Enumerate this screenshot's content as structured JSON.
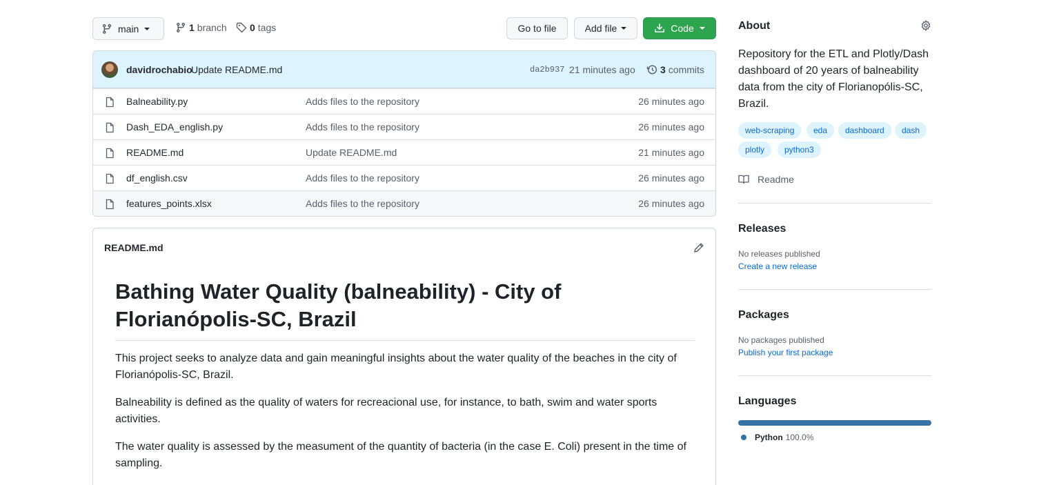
{
  "branch_select": {
    "label": "main"
  },
  "branches": {
    "count": "1",
    "label": "branch"
  },
  "tags": {
    "count": "0",
    "label": "tags"
  },
  "buttons": {
    "go_to_file": "Go to file",
    "add_file": "Add file",
    "code": "Code"
  },
  "commit": {
    "author": "davidrochabio",
    "message": "Update README.md",
    "sha": "da2b937",
    "age": "21 minutes ago",
    "commits_count": "3",
    "commits_label": "commits"
  },
  "files": [
    {
      "name": "Balneability.py",
      "message": "Adds files to the repository",
      "age": "26 minutes ago"
    },
    {
      "name": "Dash_EDA_english.py",
      "message": "Adds files to the repository",
      "age": "26 minutes ago"
    },
    {
      "name": "README.md",
      "message": "Update README.md",
      "age": "21 minutes ago"
    },
    {
      "name": "df_english.csv",
      "message": "Adds files to the repository",
      "age": "26 minutes ago"
    },
    {
      "name": "features_points.xlsx",
      "message": "Adds files to the repository",
      "age": "26 minutes ago"
    }
  ],
  "readme": {
    "filename": "README.md",
    "title": "Bathing Water Quality (balneability) - City of Florianópolis-SC, Brazil",
    "paragraphs": [
      "This project seeks to analyze data and gain meaningful insights about the water quality of the beaches in the city of Florianópolis-SC, Brazil.",
      "Balneability is defined as the quality of waters for recreacional use, for instance, to bath, swim and water sports activities.",
      "The water quality is assessed by the measument of the quantity of bacteria (in the case E. Coli) present in the time of sampling."
    ]
  },
  "about": {
    "title": "About",
    "description": "Repository for the ETL and Plotly/Dash dashboard of 20 years of balneability data from the city of Florianopólis-SC, Brazil.",
    "topics": [
      "web-scraping",
      "eda",
      "dashboard",
      "dash",
      "plotly",
      "python3"
    ],
    "readme_label": "Readme"
  },
  "releases": {
    "title": "Releases",
    "none": "No releases published",
    "link": "Create a new release"
  },
  "packages": {
    "title": "Packages",
    "none": "No packages published",
    "link": "Publish your first package"
  },
  "languages": {
    "title": "Languages",
    "items": [
      {
        "name": "Python",
        "percent": "100.0%",
        "color": "#3572A5"
      }
    ]
  },
  "colors": {
    "accent": "#0969da",
    "green": "#2da44e",
    "python": "#3572A5"
  }
}
